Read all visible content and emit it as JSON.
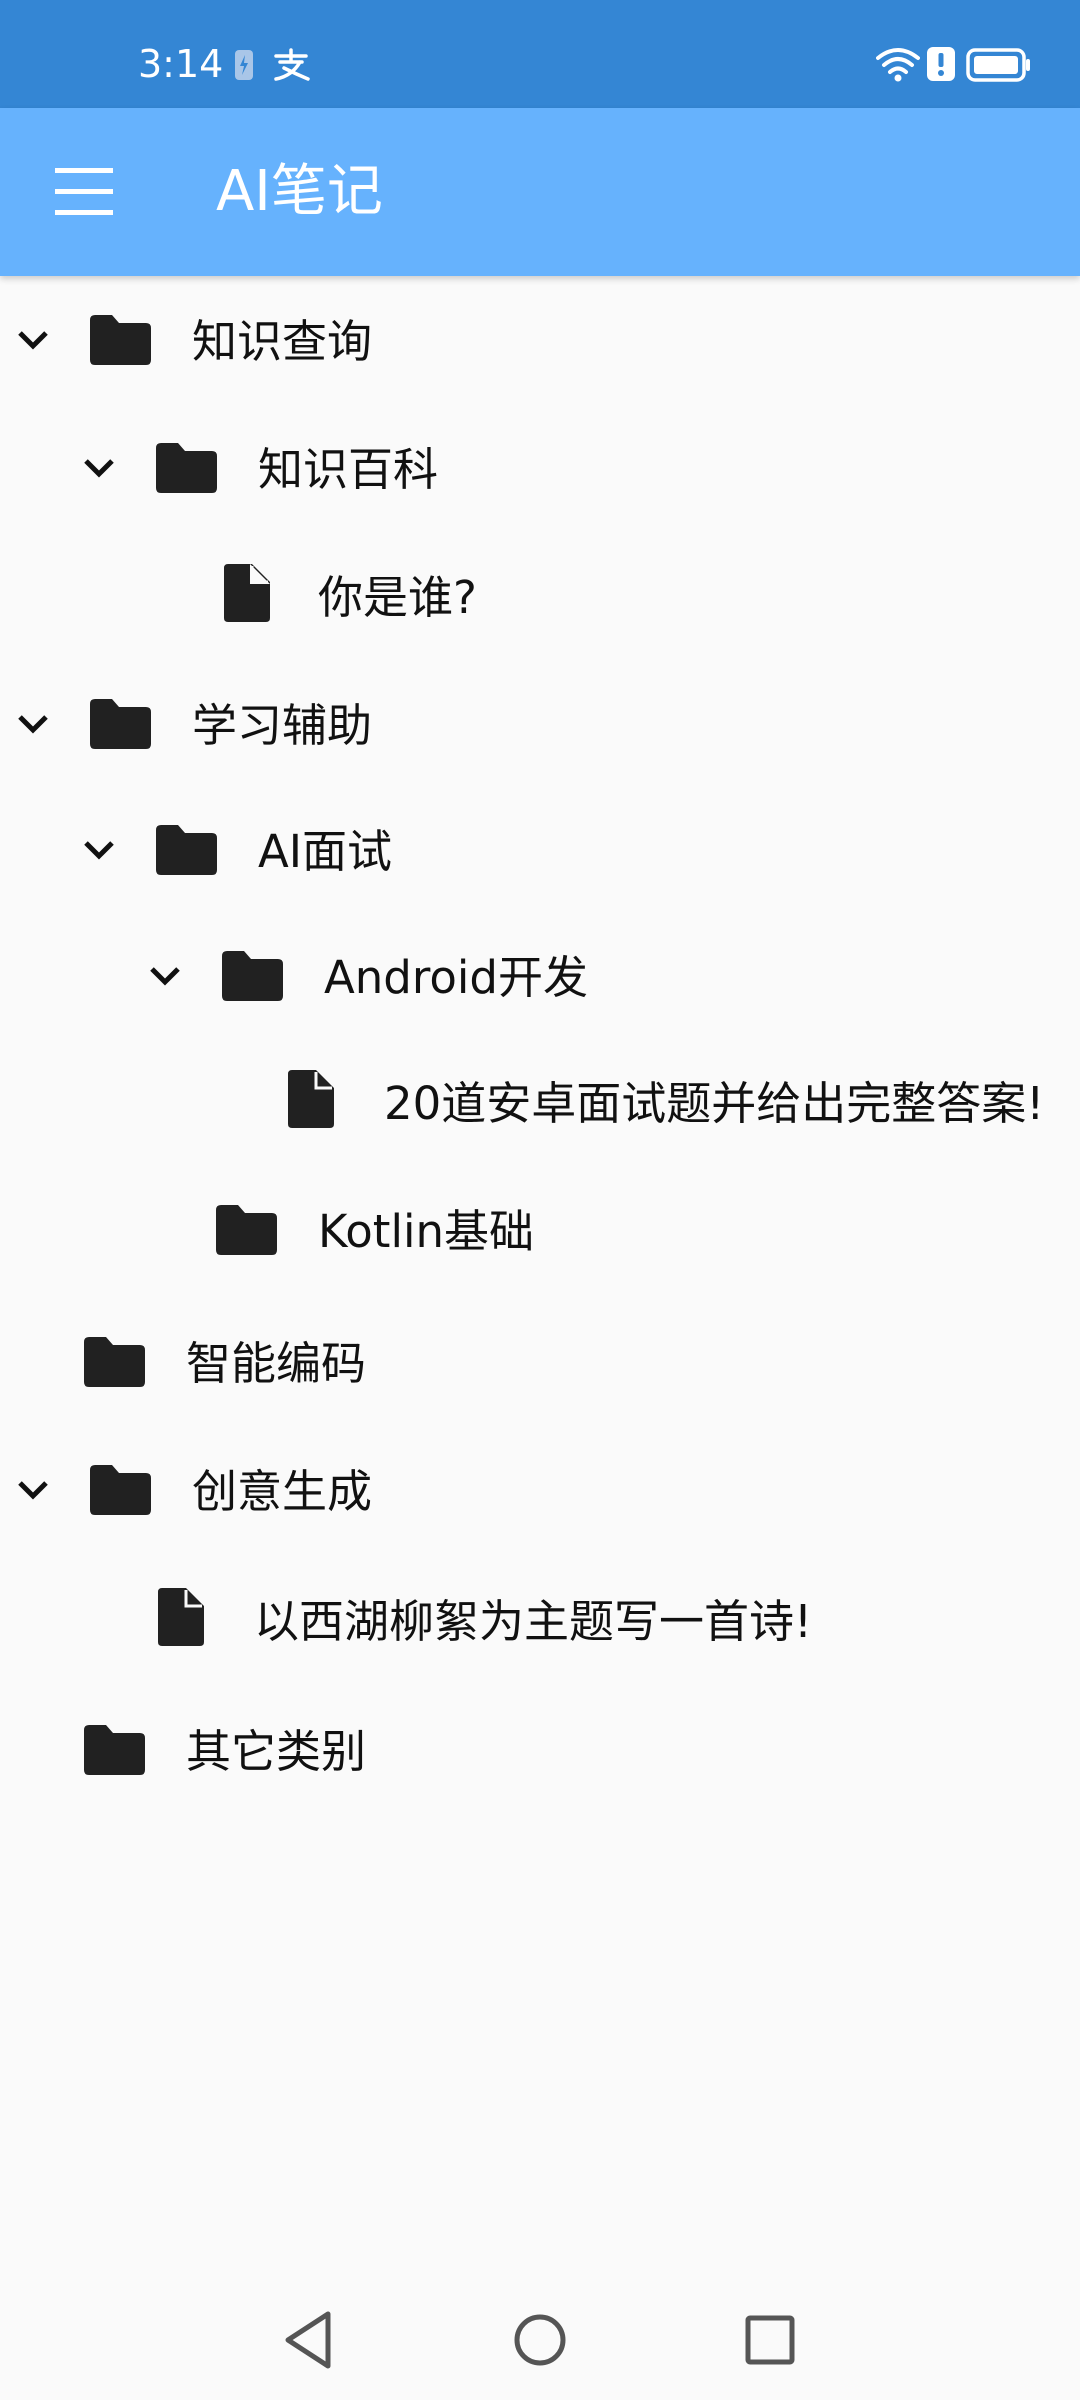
{
  "status_bar": {
    "time": "3:14",
    "icons": [
      "battery-saver-icon",
      "alipay-icon",
      "wifi-icon",
      "alert-icon",
      "battery-icon"
    ]
  },
  "app_bar": {
    "title": "AI笔记",
    "menu_icon": "menu-icon"
  },
  "tree": {
    "rows": [
      {
        "label": "知识查询",
        "type": "folder",
        "expanded": true,
        "depth": 0
      },
      {
        "label": "知识百科",
        "type": "folder",
        "expanded": true,
        "depth": 1
      },
      {
        "label": "你是谁?",
        "type": "file",
        "depth": 2
      },
      {
        "label": "学习辅助",
        "type": "folder",
        "expanded": true,
        "depth": 0
      },
      {
        "label": "AI面试",
        "type": "folder",
        "expanded": true,
        "depth": 1
      },
      {
        "label": "Android开发",
        "type": "folder",
        "expanded": true,
        "depth": 2
      },
      {
        "label": "20道安卓面试题并给出完整答案!",
        "type": "file",
        "depth": 3
      },
      {
        "label": "Kotlin基础",
        "type": "folder",
        "expanded": false,
        "depth": 2
      },
      {
        "label": "智能编码",
        "type": "folder",
        "expanded": false,
        "depth": 0
      },
      {
        "label": "创意生成",
        "type": "folder",
        "expanded": true,
        "depth": 0
      },
      {
        "label": "以西湖柳絮为主题写一首诗!",
        "type": "file",
        "depth": 1
      },
      {
        "label": "其它类别",
        "type": "folder",
        "expanded": false,
        "depth": 0
      }
    ]
  },
  "nav_bar": {
    "buttons": [
      "back-icon",
      "home-icon",
      "recents-icon"
    ]
  },
  "colors": {
    "status_bar": "#3486d4",
    "app_bar": "#66b2fd",
    "background": "#fafafa",
    "icon": "#212121"
  }
}
